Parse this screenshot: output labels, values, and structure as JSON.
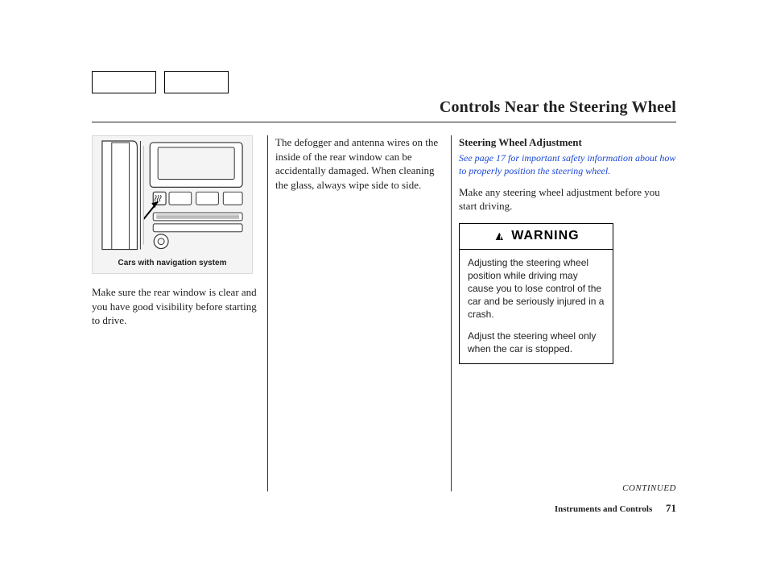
{
  "title": "Controls Near the Steering Wheel",
  "figure": {
    "caption": "Cars with navigation system"
  },
  "col1": {
    "p1": "Make sure the rear window is clear and you have good visibility before starting to drive."
  },
  "col2": {
    "p1": "The defogger and antenna wires on the inside of the rear window can be accidentally damaged. When cleaning the glass, always wipe side to side."
  },
  "col3": {
    "heading": "Steering Wheel Adjustment",
    "safety_pre": "See page ",
    "safety_page": "17",
    "safety_post": " for important safety information about how to properly position the steering wheel.",
    "p1": "Make any steering wheel adjustment before you start driving.",
    "warning_label": "WARNING",
    "warning_p1": "Adjusting the steering wheel position while driving may cause you to lose control of the car and be seriously injured in a crash.",
    "warning_p2": "Adjust the steering wheel only when the car is stopped."
  },
  "continued": "CONTINUED",
  "footer_section": "Instruments and Controls",
  "page_number": "71"
}
